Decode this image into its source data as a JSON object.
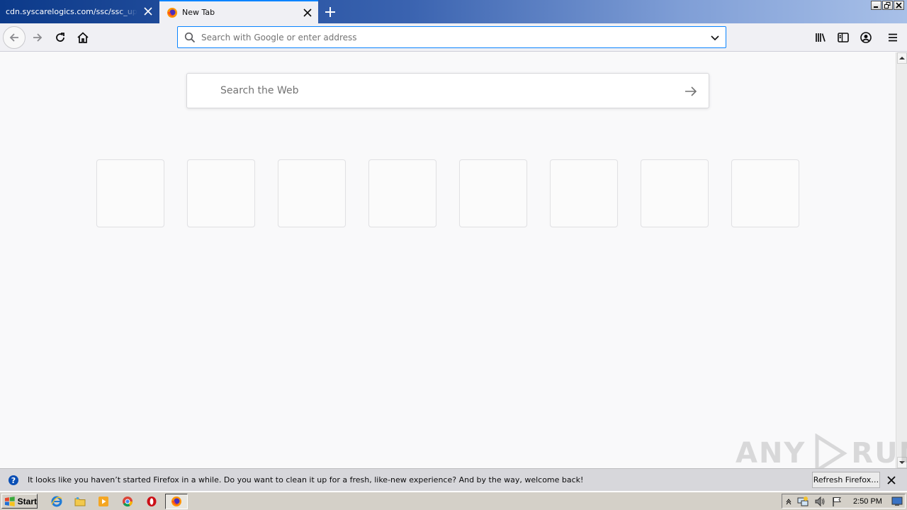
{
  "browser": {
    "tabs": [
      {
        "title": "cdn.syscarelogics.com/ssc/ssc_upgrad",
        "active": false
      },
      {
        "title": "New Tab",
        "active": true
      }
    ],
    "urlbar": {
      "placeholder": "Search with Google or enter address",
      "value": ""
    },
    "accent_color": "#0a84ff"
  },
  "newtab": {
    "search_placeholder": "Search the Web",
    "tile_count": 8
  },
  "notification": {
    "message": "It looks like you haven’t started Firefox in a while. Do you want to clean it up for a fresh, like-new experience? And by the way, welcome back!",
    "button_label": "Refresh Firefox…"
  },
  "watermark": {
    "left": "ANY",
    "right": "RUN"
  },
  "taskbar": {
    "start_label": "Start",
    "clock": "2:50 PM"
  }
}
